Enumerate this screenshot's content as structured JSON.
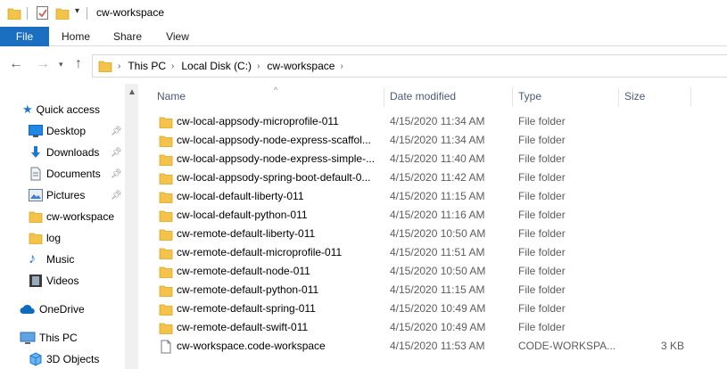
{
  "window": {
    "title": "cw-workspace"
  },
  "ribbon": {
    "tabs": [
      "File",
      "Home",
      "Share",
      "View"
    ]
  },
  "address": {
    "crumbs": [
      "This PC",
      "Local Disk (C:)",
      "cw-workspace"
    ]
  },
  "nav": {
    "items": [
      {
        "label": "Quick access",
        "icon": "star-icon",
        "pinned": false
      },
      {
        "label": "Desktop",
        "icon": "desktop-icon",
        "pinned": true
      },
      {
        "label": "Downloads",
        "icon": "download-icon",
        "pinned": true
      },
      {
        "label": "Documents",
        "icon": "document-icon",
        "pinned": true
      },
      {
        "label": "Pictures",
        "icon": "pictures-icon",
        "pinned": true
      },
      {
        "label": "cw-workspace",
        "icon": "folder-icon",
        "pinned": false
      },
      {
        "label": "log",
        "icon": "folder-icon",
        "pinned": false
      },
      {
        "label": "Music",
        "icon": "music-icon",
        "pinned": false
      },
      {
        "label": "Videos",
        "icon": "videos-icon",
        "pinned": false
      },
      {
        "label": "OneDrive",
        "icon": "cloud-icon",
        "pinned": false
      },
      {
        "label": "This PC",
        "icon": "computer-icon",
        "pinned": false
      },
      {
        "label": "3D Objects",
        "icon": "cube-icon",
        "pinned": false
      }
    ]
  },
  "list": {
    "columns": {
      "name": "Name",
      "date": "Date modified",
      "type": "Type",
      "size": "Size"
    },
    "rows": [
      {
        "name": "cw-local-appsody-microprofile-011",
        "date": "4/15/2020 11:34 AM",
        "type": "File folder",
        "size": "",
        "icon": "folder-icon"
      },
      {
        "name": "cw-local-appsody-node-express-scaffol...",
        "date": "4/15/2020 11:34 AM",
        "type": "File folder",
        "size": "",
        "icon": "folder-icon"
      },
      {
        "name": "cw-local-appsody-node-express-simple-...",
        "date": "4/15/2020 11:40 AM",
        "type": "File folder",
        "size": "",
        "icon": "folder-icon"
      },
      {
        "name": "cw-local-appsody-spring-boot-default-0...",
        "date": "4/15/2020 11:42 AM",
        "type": "File folder",
        "size": "",
        "icon": "folder-icon"
      },
      {
        "name": "cw-local-default-liberty-011",
        "date": "4/15/2020 11:15 AM",
        "type": "File folder",
        "size": "",
        "icon": "folder-icon"
      },
      {
        "name": "cw-local-default-python-011",
        "date": "4/15/2020 11:16 AM",
        "type": "File folder",
        "size": "",
        "icon": "folder-icon"
      },
      {
        "name": "cw-remote-default-liberty-011",
        "date": "4/15/2020 10:50 AM",
        "type": "File folder",
        "size": "",
        "icon": "folder-icon"
      },
      {
        "name": "cw-remote-default-microprofile-011",
        "date": "4/15/2020 11:51 AM",
        "type": "File folder",
        "size": "",
        "icon": "folder-icon"
      },
      {
        "name": "cw-remote-default-node-011",
        "date": "4/15/2020 10:50 AM",
        "type": "File folder",
        "size": "",
        "icon": "folder-icon"
      },
      {
        "name": "cw-remote-default-python-011",
        "date": "4/15/2020 11:15 AM",
        "type": "File folder",
        "size": "",
        "icon": "folder-icon"
      },
      {
        "name": "cw-remote-default-spring-011",
        "date": "4/15/2020 10:49 AM",
        "type": "File folder",
        "size": "",
        "icon": "folder-icon"
      },
      {
        "name": "cw-remote-default-swift-011",
        "date": "4/15/2020 10:49 AM",
        "type": "File folder",
        "size": "",
        "icon": "folder-icon"
      },
      {
        "name": "cw-workspace.code-workspace",
        "date": "4/15/2020 11:53 AM",
        "type": "CODE-WORKSPA...",
        "size": "3 KB",
        "icon": "file-icon"
      }
    ]
  },
  "colors": {
    "accent": "#1a6fc0",
    "folder": "#f5c24a",
    "header_text": "#4a5a78"
  }
}
